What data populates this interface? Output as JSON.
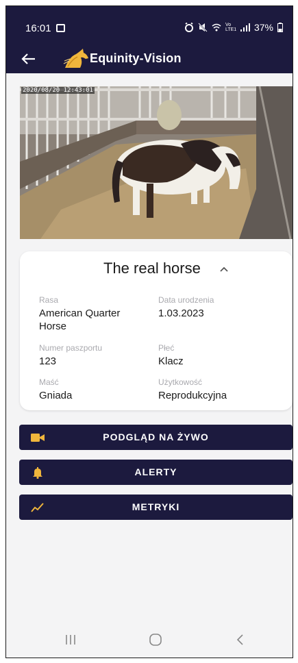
{
  "status_bar": {
    "time": "16:01",
    "battery": "37%",
    "network_label": "Vo LTE1"
  },
  "app_bar": {
    "title": "Equinity-Vision"
  },
  "camera": {
    "timestamp": "2020/08/20 12:43:01"
  },
  "horse": {
    "name": "The real horse",
    "fields": [
      {
        "label": "Rasa",
        "value": "American Quarter Horse"
      },
      {
        "label": "Data urodzenia",
        "value": "1.03.2023"
      },
      {
        "label": "Numer paszportu",
        "value": "123"
      },
      {
        "label": "Płeć",
        "value": "Klacz"
      },
      {
        "label": "Maść",
        "value": "Gniada"
      },
      {
        "label": "Użytkowość",
        "value": "Reprodukcyjna"
      }
    ]
  },
  "actions": [
    {
      "label": "PODGLĄD NA ŻYWO",
      "icon": "video-camera-icon"
    },
    {
      "label": "ALERTY",
      "icon": "bell-icon"
    },
    {
      "label": "METRYKI",
      "icon": "trend-chart-icon"
    }
  ],
  "colors": {
    "primary": "#1c1a3e",
    "accent": "#f0b63c",
    "background": "#f4f4f5",
    "label_gray": "#a9a9ae"
  }
}
